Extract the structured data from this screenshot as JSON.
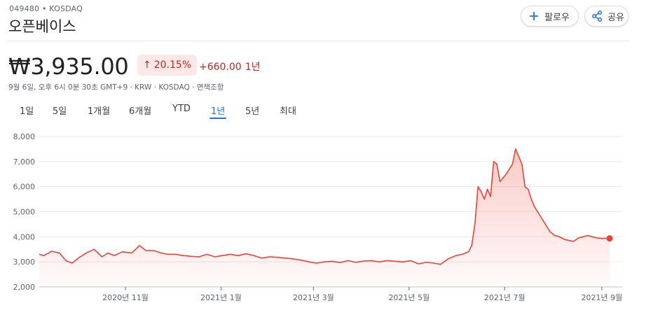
{
  "header": {
    "ticker_exchange": "049480 • KOSDAQ",
    "company_name": "오픈베이스",
    "follow_label": "팔로우",
    "share_label": "공유",
    "accent_color": "#1a73e8"
  },
  "quote": {
    "price": "₩3,935.00",
    "percent_arrow": "↑",
    "percent_change": "20.15%",
    "abs_change": "+660.00",
    "period": "1년",
    "change_color": "#c5221f",
    "meta": "9월 6일, 오후 6시 0분 30초 GMT+9 · KRW · KOSDAQ · 면책조항"
  },
  "tabs": [
    {
      "label": "1일",
      "active": false
    },
    {
      "label": "5일",
      "active": false
    },
    {
      "label": "1개월",
      "active": false
    },
    {
      "label": "6개월",
      "active": false
    },
    {
      "label": "YTD",
      "active": false
    },
    {
      "label": "1년",
      "active": true
    },
    {
      "label": "5년",
      "active": false
    },
    {
      "label": "최대",
      "active": false
    }
  ],
  "chart_data": {
    "type": "area",
    "title": "",
    "xlabel": "",
    "ylabel": "",
    "ylim": [
      2000,
      8000
    ],
    "yticks": [
      2000,
      3000,
      4000,
      5000,
      6000,
      7000,
      8000
    ],
    "ytick_labels": [
      "2,000",
      "3,000",
      "4,000",
      "5,000",
      "6,000",
      "7,000",
      "8,000"
    ],
    "xlim": [
      "2020-09-07",
      "2021-09-06"
    ],
    "xticks": [
      "2020-11-01",
      "2021-01-01",
      "2021-03-01",
      "2021-05-01",
      "2021-07-01",
      "2021-09-01"
    ],
    "xtick_labels": [
      "2020년 11월",
      "2021년 1월",
      "2021년 3월",
      "2021년 5월",
      "2021년 7월",
      "2021년 9월"
    ],
    "grid": "horizontal",
    "line_color": "#ea4335",
    "series": [
      {
        "x": [
          "2020-09-07",
          "2020-09-10",
          "2020-09-15",
          "2020-09-20",
          "2020-09-24",
          "2020-09-28",
          "2020-10-02",
          "2020-10-07",
          "2020-10-12",
          "2020-10-17",
          "2020-10-21",
          "2020-10-25",
          "2020-10-30",
          "2020-11-05",
          "2020-11-10",
          "2020-11-14",
          "2020-11-19",
          "2020-11-24",
          "2020-11-28",
          "2020-12-03",
          "2020-12-08",
          "2020-12-13",
          "2020-12-18",
          "2020-12-23",
          "2020-12-28",
          "2021-01-02",
          "2021-01-07",
          "2021-01-12",
          "2021-01-17",
          "2021-01-22",
          "2021-01-27",
          "2021-02-01",
          "2021-02-06",
          "2021-02-11",
          "2021-02-16",
          "2021-02-21",
          "2021-02-26",
          "2021-03-03",
          "2021-03-08",
          "2021-03-13",
          "2021-03-18",
          "2021-03-23",
          "2021-03-28",
          "2021-04-02",
          "2021-04-07",
          "2021-04-12",
          "2021-04-17",
          "2021-04-22",
          "2021-04-27",
          "2021-05-02",
          "2021-05-07",
          "2021-05-12",
          "2021-05-17",
          "2021-05-21",
          "2021-05-26",
          "2021-05-31",
          "2021-06-04",
          "2021-06-08",
          "2021-06-10",
          "2021-06-12",
          "2021-06-14",
          "2021-06-16",
          "2021-06-18",
          "2021-06-20",
          "2021-06-22",
          "2021-06-24",
          "2021-06-26",
          "2021-06-28",
          "2021-06-30",
          "2021-07-02",
          "2021-07-04",
          "2021-07-06",
          "2021-07-08",
          "2021-07-10",
          "2021-07-12",
          "2021-07-14",
          "2021-07-16",
          "2021-07-18",
          "2021-07-20",
          "2021-07-22",
          "2021-07-24",
          "2021-07-26",
          "2021-07-28",
          "2021-07-30",
          "2021-08-02",
          "2021-08-05",
          "2021-08-08",
          "2021-08-11",
          "2021-08-14",
          "2021-08-17",
          "2021-08-20",
          "2021-08-23",
          "2021-08-26",
          "2021-08-29",
          "2021-09-01",
          "2021-09-04",
          "2021-09-06"
        ],
        "y": [
          3300,
          3250,
          3420,
          3350,
          3050,
          2950,
          3150,
          3350,
          3500,
          3200,
          3350,
          3250,
          3400,
          3350,
          3650,
          3450,
          3450,
          3350,
          3300,
          3300,
          3250,
          3220,
          3200,
          3300,
          3200,
          3250,
          3300,
          3250,
          3320,
          3250,
          3150,
          3200,
          3180,
          3150,
          3120,
          3070,
          3000,
          2950,
          3000,
          3020,
          2970,
          3050,
          2980,
          3030,
          3050,
          3000,
          3050,
          3020,
          3000,
          3050,
          2920,
          2980,
          2950,
          2900,
          3120,
          3250,
          3300,
          3400,
          3650,
          4500,
          6000,
          5800,
          5500,
          5900,
          5600,
          7000,
          6900,
          6200,
          6350,
          6500,
          6700,
          6900,
          7500,
          7200,
          6900,
          6000,
          5900,
          5500,
          5200,
          5000,
          4800,
          4600,
          4400,
          4200,
          4050,
          4000,
          3900,
          3850,
          3820,
          3950,
          4000,
          4050,
          4000,
          3950,
          3935,
          3935,
          3935
        ]
      }
    ]
  }
}
